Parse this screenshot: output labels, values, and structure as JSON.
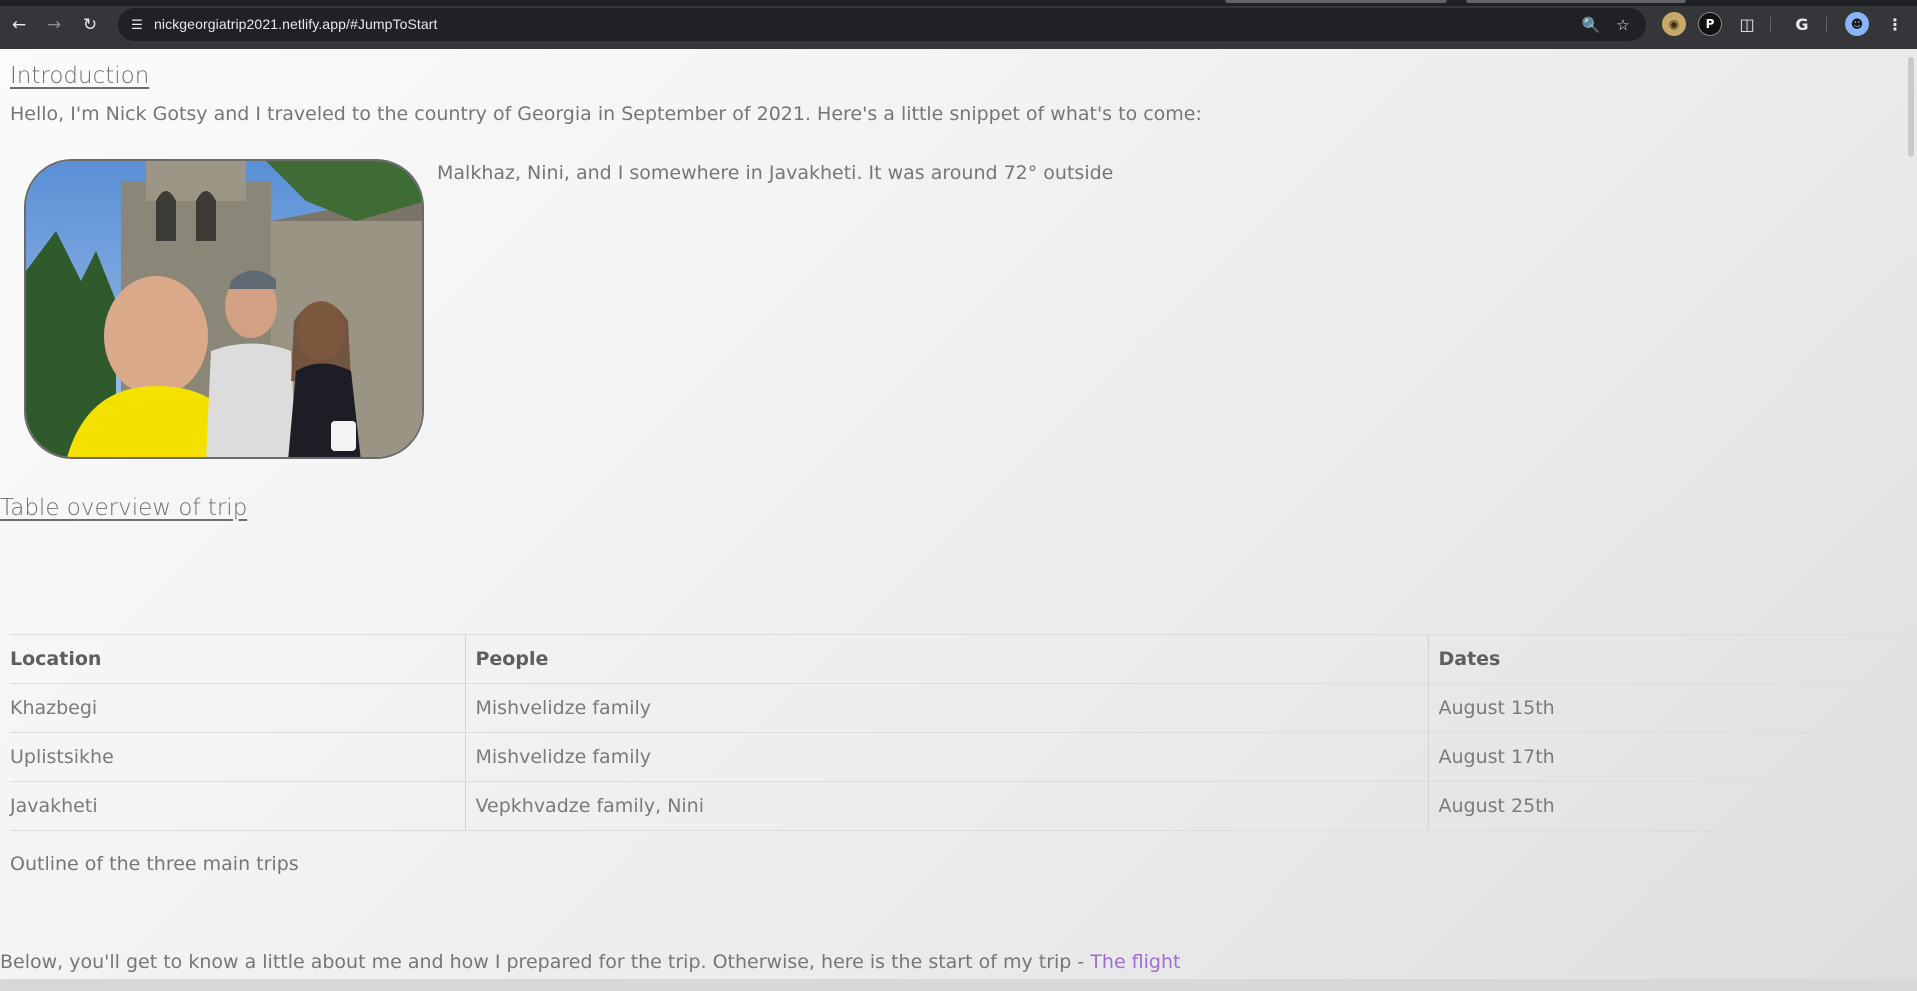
{
  "browser": {
    "url": "nickgeorgiatrip2021.netlify.app/#JumpToStart",
    "icons": [
      "back-icon",
      "forward-icon",
      "reload-icon",
      "site-settings-icon",
      "zoom-icon",
      "bookmark-star-icon",
      "extension-icon",
      "puzzle-icon",
      "google-icon",
      "profile-avatar-icon",
      "menu-icon"
    ]
  },
  "intro": {
    "heading": "Introduction",
    "text": "Hello, I'm Nick Gotsy and I traveled to the country of Georgia in September of 2021. Here's a little snippet of what's to come:",
    "photo_caption": "Malkhaz, Nini, and I somewhere in Javakheti. It was around 72° outside"
  },
  "overview": {
    "heading": "Table overview of trip",
    "columns": [
      "Location",
      "People",
      "Dates"
    ],
    "rows": [
      [
        "Khazbegi",
        "Mishvelidze family",
        "August 15th"
      ],
      [
        "Uplistsikhe",
        "Mishvelidze family",
        "August 17th"
      ],
      [
        "Javakheti",
        "Vepkhvadze family, Nini",
        "August 25th"
      ]
    ],
    "table_caption": "Outline of the three main trips"
  },
  "footer": {
    "text": "Below, you'll get to know a little about me and how I prepared for the trip. Otherwise, here is the start of my trip - ",
    "link_label": "The flight"
  },
  "colors": {
    "link": "#9b6fd0",
    "text": "#767676"
  }
}
